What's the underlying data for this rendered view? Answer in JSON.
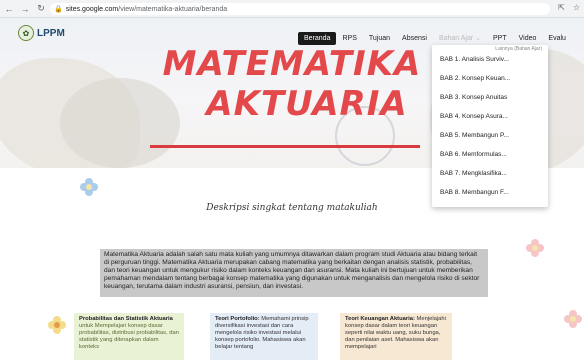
{
  "browser": {
    "url_host": "sites.google.com",
    "url_path": "/view/matematika-aktuaria/beranda",
    "back_icon": "arrow-left-icon",
    "forward_icon": "arrow-right-icon",
    "reload_icon": "reload-icon"
  },
  "site": {
    "logo_text": "LPPM",
    "nav": [
      {
        "label": "Beranda",
        "active": true
      },
      {
        "label": "RPS"
      },
      {
        "label": "Tujuan"
      },
      {
        "label": "Absensi"
      },
      {
        "label": "Bahan Ajar",
        "has_dropdown": true
      },
      {
        "label": "PPT"
      },
      {
        "label": "Video"
      },
      {
        "label": "Evalu"
      }
    ]
  },
  "hero": {
    "title_line1": "MATEMATIKA",
    "title_line2": "AKTUARIA",
    "title_color": "#e3494b"
  },
  "dropdown": {
    "header": "Lainnya (Bahan Ajar)",
    "items": [
      "BAB 1. Analisis Surviv...",
      "BAB 2. Konsep Keuan...",
      "BAB 3. Konsep Anuitas",
      "BAB 4. Konsep Asura...",
      "BAB 5. Membangun P...",
      "BAB 6. Memformulas...",
      "BAB 7. Mengklasifika...",
      "BAB 8. Membangun F..."
    ]
  },
  "description": {
    "title": "Deskripsi singkat tentang matakuliah",
    "body": "Matematika Aktuaria adalah salah satu mata kuliah yang umumnya ditawarkan dalam program studi Aktuaria atau bidang terkait di perguruan tinggi. Matematika Aktuaria merupakan cabang matematika yang berkaitan dengan analisis statistik, probabilitas, dan teori keuangan untuk mengukur risiko dalam konteks keuangan dan asuransi. Mata kuliah ini bertujuan untuk memberikan pemahaman mendalam tentang berbagai konsep matematika yang digunakan untuk menganalisis dan mengelola risiko di sektor keuangan, terutama dalam industri asuransi, pensiun, dan investasi."
  },
  "cards": [
    {
      "title": "Probabilitas dan Statistik Aktuaria",
      "text": "untuk Mempelajari konsep dasar probabilitas, distribusi probabilitas, dan statistik yang diterapkan dalam konteks"
    },
    {
      "title": "Teori Portofolio:",
      "text": "Memahami prinsip diversifikasi investasi dan cara mengelola risiko investasi melalui konsep portofolio. Mahasiswa akan belajar tentang"
    },
    {
      "title": "Teori Keuangan Aktuaria:",
      "text": "Menjelajahi konsep dasar dalam teori keuangan seperti nilai waktu uang, suku bunga, dan penilaian aset. Mahasiswa akan mempelajari"
    }
  ]
}
